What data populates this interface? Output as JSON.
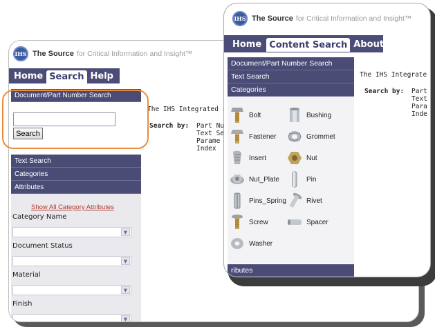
{
  "back": {
    "brand": {
      "name": "The Source",
      "tagline": "for Critical Information and Insight™",
      "logo_text": "IHS"
    },
    "nav": [
      "Home",
      "Search",
      "Help"
    ],
    "doc_search_header": "Document/Part Number Search",
    "search_button": "Search",
    "search_value": "",
    "sections": [
      "Text Search",
      "Categories",
      "Attributes"
    ],
    "show_all_link": "Show All Category Attributes",
    "fields": [
      "Category Name",
      "Document Status",
      "Material",
      "Finish"
    ],
    "intro": "The IHS Integrated s",
    "search_by_label": "Search by:",
    "search_by_items": [
      "Part Nu",
      "Text Se",
      "Parame",
      "Index"
    ]
  },
  "front": {
    "brand": {
      "name": "The Source",
      "tagline": "for Critical Information and Insight™",
      "logo_text": "IHS"
    },
    "nav": [
      "Home",
      "Content Search",
      "About"
    ],
    "sections": [
      "Document/Part Number Search",
      "Text Search",
      "Categories"
    ],
    "categories": [
      "Bolt",
      "Bushing",
      "Fastener",
      "Grommet",
      "Insert",
      "Nut",
      "Nut_Plate",
      "Pin",
      "Pins_Spring",
      "Rivet",
      "Screw",
      "Spacer",
      "Washer"
    ],
    "attributes_partial": "ributes",
    "intro": "The IHS Integrate",
    "search_by_label": "Search by:",
    "search_by_items": [
      "Part",
      "Text",
      "Para",
      "Inde"
    ]
  },
  "colors": {
    "nav_bg": "#4b4c77",
    "sidebar": "#4a4c76",
    "highlight": "#ec8a3a",
    "link": "#b5392d"
  }
}
